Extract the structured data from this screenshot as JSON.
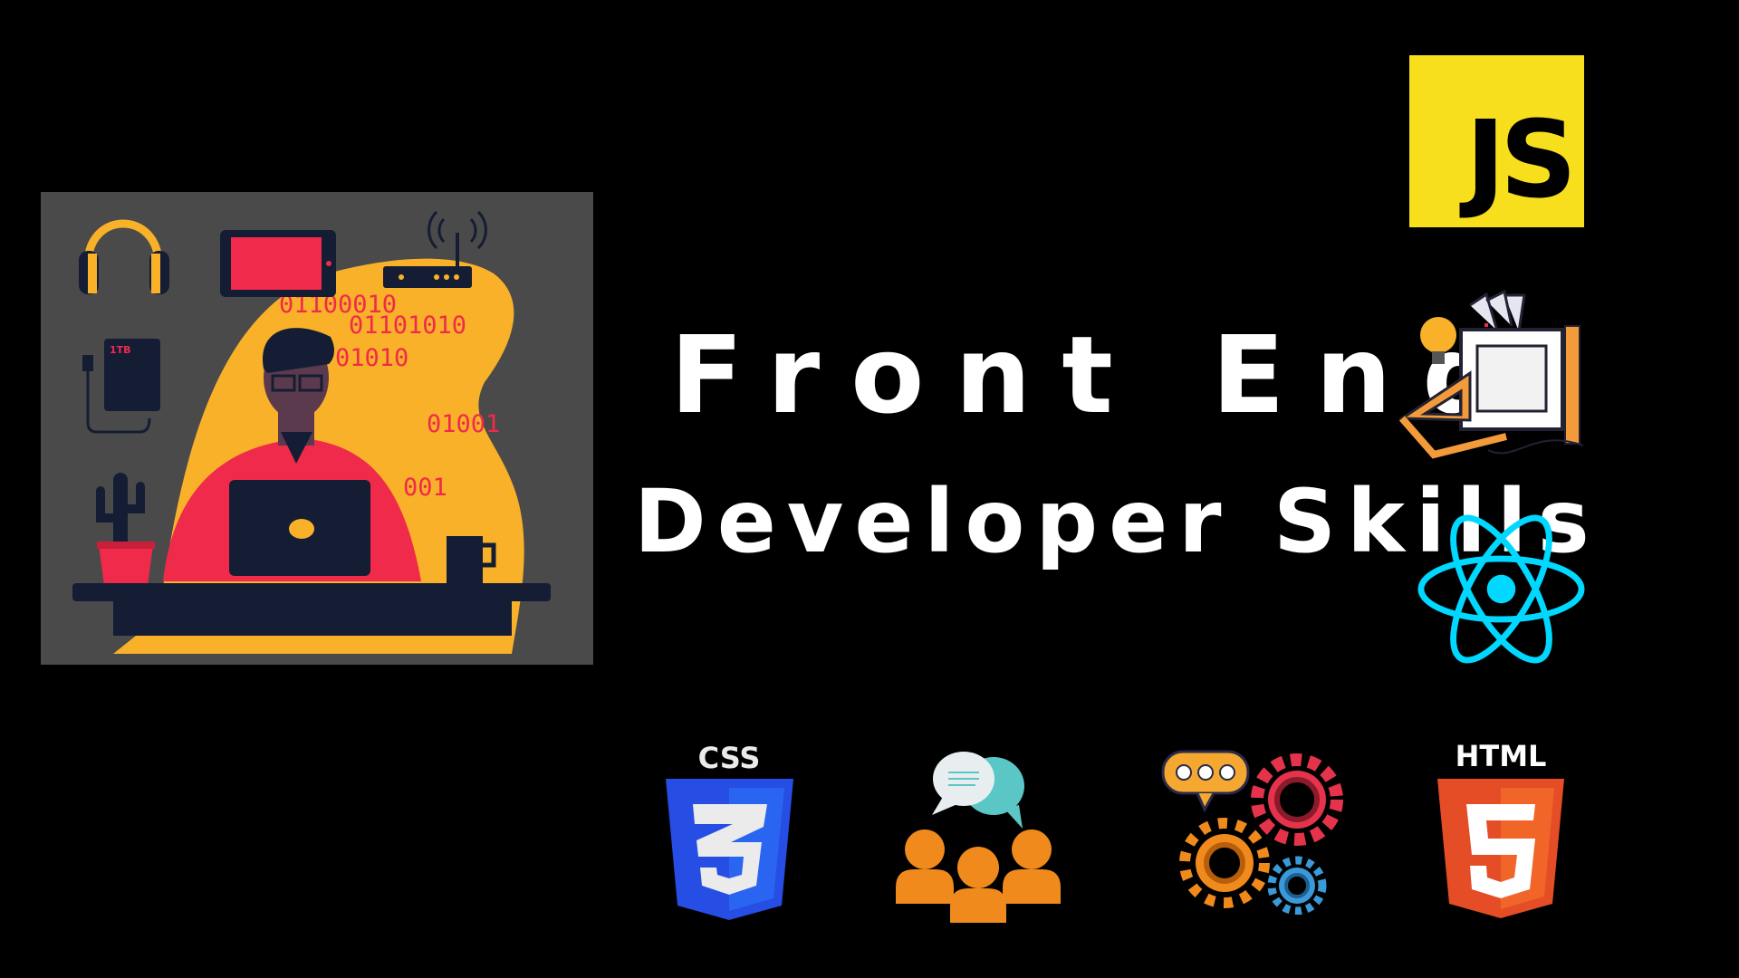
{
  "title": {
    "line1": "Front End",
    "line2": "Developer Skills"
  },
  "illustration": {
    "binary": [
      "01100010",
      "01101010",
      "01010",
      "01001",
      "001"
    ],
    "drive_label": "1TB"
  },
  "logos": {
    "js": "JS",
    "css": "CSS",
    "html": "HTML"
  },
  "colors": {
    "background": "#000000",
    "illustration_bg": "#4a4a4a",
    "accent_yellow": "#f9b12a",
    "accent_red": "#f02a4a",
    "navy": "#141d33",
    "js_yellow": "#f7df1e",
    "react_cyan": "#00d8ff",
    "css_blue": "#264de4",
    "html_orange": "#e44d26"
  },
  "icons": [
    "headphones-icon",
    "tablet-icon",
    "router-icon",
    "hard-drive-icon",
    "cactus-icon",
    "mug-icon",
    "laptop-icon",
    "design-tools-icon",
    "react-icon",
    "css3-icon",
    "team-communication-icon",
    "gears-chat-icon",
    "html5-icon",
    "js-logo"
  ]
}
